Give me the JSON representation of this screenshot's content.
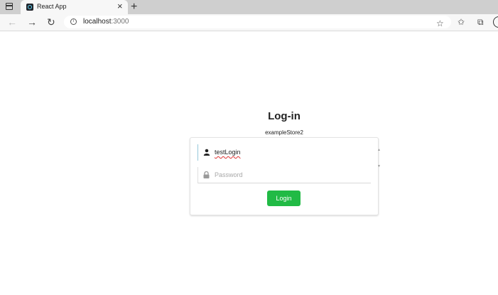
{
  "browser": {
    "tab_title": "React App",
    "tab_close": "×",
    "new_tab": "+",
    "url_host": "localhost",
    "url_port": ":3000"
  },
  "icons": {
    "back": "←",
    "forward": "→",
    "reload": "↻",
    "info": "i",
    "favorite": "☆",
    "favorites": "✩",
    "collections": "⧉"
  },
  "login": {
    "title": "Log-in",
    "store_name": "exampleStore2",
    "username_value": "testLogin",
    "password_placeholder": "Password",
    "button_label": "Login"
  },
  "colors": {
    "accent": "#21ba45",
    "focus_border": "#96c8da"
  }
}
